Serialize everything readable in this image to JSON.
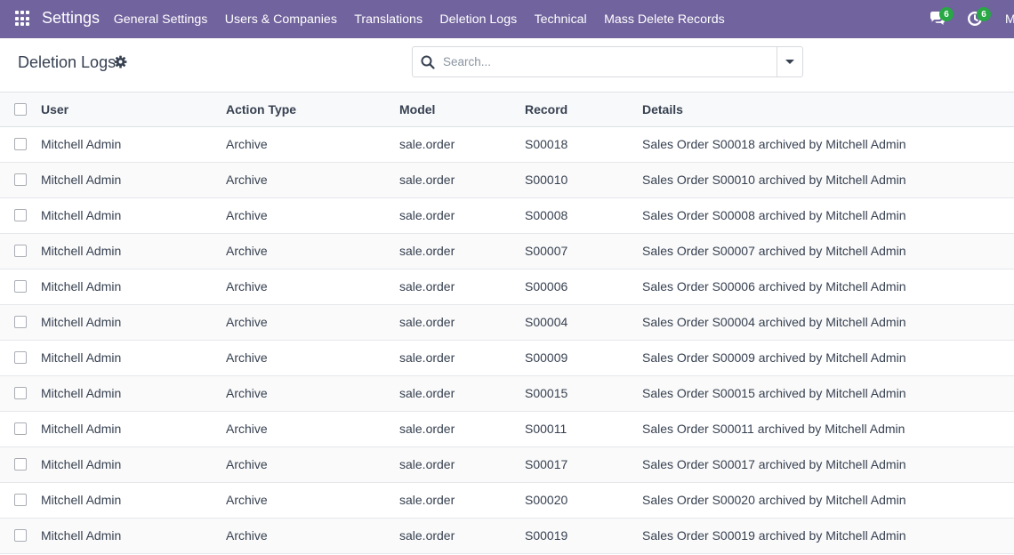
{
  "navbar": {
    "app_name": "Settings",
    "menu": [
      "General Settings",
      "Users & Companies",
      "Translations",
      "Deletion Logs",
      "Technical",
      "Mass Delete Records"
    ],
    "messages_count": "6",
    "activities_count": "6",
    "user_initial": "M",
    "bg_color": "#71639e"
  },
  "control_panel": {
    "title": "Deletion Logs",
    "search_placeholder": "Search..."
  },
  "table": {
    "columns": [
      "User",
      "Action Type",
      "Model",
      "Record",
      "Details"
    ],
    "rows": [
      [
        "Mitchell Admin",
        "Archive",
        "sale.order",
        "S00018",
        "Sales Order S00018 archived by Mitchell Admin"
      ],
      [
        "Mitchell Admin",
        "Archive",
        "sale.order",
        "S00010",
        "Sales Order S00010 archived by Mitchell Admin"
      ],
      [
        "Mitchell Admin",
        "Archive",
        "sale.order",
        "S00008",
        "Sales Order S00008 archived by Mitchell Admin"
      ],
      [
        "Mitchell Admin",
        "Archive",
        "sale.order",
        "S00007",
        "Sales Order S00007 archived by Mitchell Admin"
      ],
      [
        "Mitchell Admin",
        "Archive",
        "sale.order",
        "S00006",
        "Sales Order S00006 archived by Mitchell Admin"
      ],
      [
        "Mitchell Admin",
        "Archive",
        "sale.order",
        "S00004",
        "Sales Order S00004 archived by Mitchell Admin"
      ],
      [
        "Mitchell Admin",
        "Archive",
        "sale.order",
        "S00009",
        "Sales Order S00009 archived by Mitchell Admin"
      ],
      [
        "Mitchell Admin",
        "Archive",
        "sale.order",
        "S00015",
        "Sales Order S00015 archived by Mitchell Admin"
      ],
      [
        "Mitchell Admin",
        "Archive",
        "sale.order",
        "S00011",
        "Sales Order S00011 archived by Mitchell Admin"
      ],
      [
        "Mitchell Admin",
        "Archive",
        "sale.order",
        "S00017",
        "Sales Order S00017 archived by Mitchell Admin"
      ],
      [
        "Mitchell Admin",
        "Archive",
        "sale.order",
        "S00020",
        "Sales Order S00020 archived by Mitchell Admin"
      ],
      [
        "Mitchell Admin",
        "Archive",
        "sale.order",
        "S00019",
        "Sales Order S00019 archived by Mitchell Admin"
      ]
    ]
  }
}
